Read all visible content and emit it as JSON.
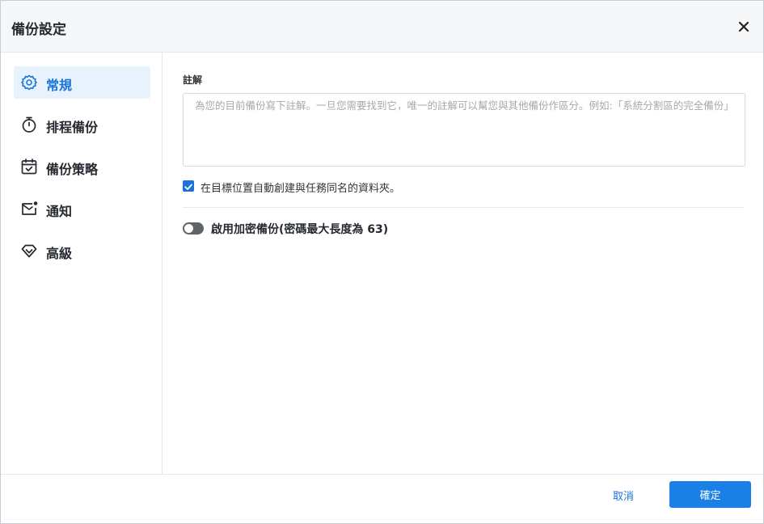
{
  "dialog": {
    "title": "備份設定",
    "close_icon": "close-icon"
  },
  "sidebar": {
    "items": [
      {
        "label": "常規",
        "icon": "gear-icon",
        "active": true
      },
      {
        "label": "排程備份",
        "icon": "timer-icon",
        "active": false
      },
      {
        "label": "備份策略",
        "icon": "calendar-check-icon",
        "active": false
      },
      {
        "label": "通知",
        "icon": "mail-notification-icon",
        "active": false
      },
      {
        "label": "高級",
        "icon": "diamond-icon",
        "active": false
      }
    ]
  },
  "general": {
    "note_label": "註解",
    "note_placeholder": "為您的目前備份寫下註解。一旦您需要找到它，唯一的註解可以幫您與其他備份作區分。例如:「系統分割區的完全備份」",
    "note_value": "",
    "auto_folder_label": "在目標位置自動創建與任務同名的資料夾。",
    "auto_folder_checked": true,
    "encryption_label": "啟用加密備份(密碼最大長度為 63)",
    "encryption_enabled": false
  },
  "footer": {
    "cancel_label": "取消",
    "ok_label": "確定"
  },
  "colors": {
    "accent": "#1a73d9",
    "primary_button": "#1a80e6",
    "active_nav_bg": "#e8f2fc",
    "toggle_off": "#5f6368"
  }
}
